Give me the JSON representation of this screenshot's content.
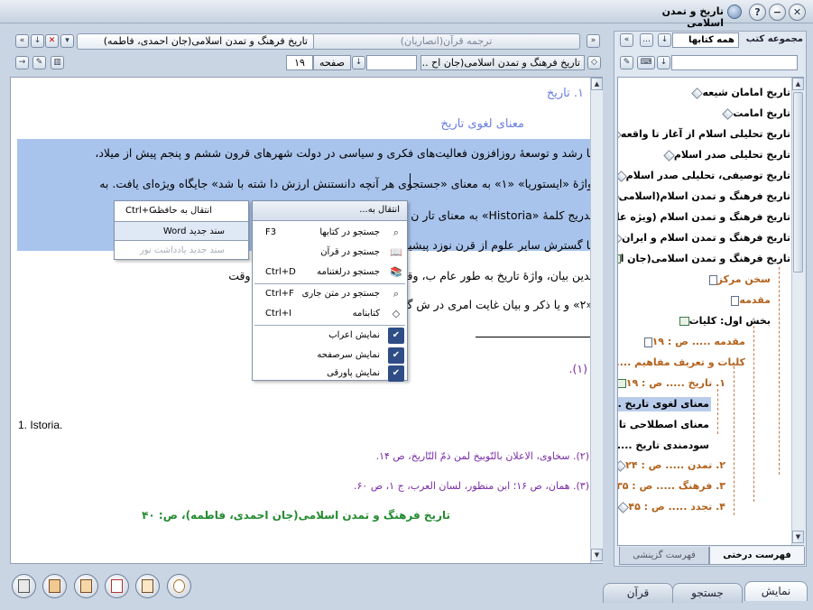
{
  "window": {
    "title": "تاریخ و تمدن اسلامی"
  },
  "doc_header": {
    "tab_primary": "تاریخ فرهنگ و تمدن اسلامی(جان احمدی، فاطمه)",
    "tab_secondary": "ترجمه قرآن(انصاریان)",
    "book_selector": "تاریخ فرهنگ و تمدن اسلامی(جان اح ...",
    "page_label": "صفحه",
    "page_value": "۱۹"
  },
  "right_header": {
    "title": "مجموعه کتب",
    "filter_value": "همه کتابها",
    "search_value": ""
  },
  "document": {
    "heading1": "۱. تاریخ",
    "heading2": "معنای لغوی تاریخ",
    "lines": [
      "یا رشد و توسعهٔ روزافزون فعالیت‌های فکری و سیاسی در دولت شهرهای قرون  ششم و پنجم پیش از میلاد،",
      "واژهٔ «ایستوریا» «۱» به معنای «جستجوی هر آنچه دانستنش ارزش دا شته با شد» جایگاه ویژه‌ای یافت. به",
      "تدریج کلمهٔ «Historia» به معنای تار                                                           ن خود را بازیافت.",
      "با گسترش سایر علوم از قرن نوزد                                                          پیشین یافت.",
      "بدین بیان، واژهٔ تاریخ به طور عام                                      ب، وقت و آگاهی‌دادن از آن، شناساندن وقت",
      "«۲» و یا ذکر و بیان غایت امری در                                     ش گذ شته، سیر زمان"
    ],
    "fn1": "(۱).",
    "fn1_en": "1. Istoria.",
    "fn2": "(۲). سخاوی، الاعلان بالتّوبیخ لمن ذمّ التّاریخ، ص ۱۴.",
    "fn3": "(۳). همان، ص ۱۶؛ ابن منظور، لسان العرب، ج ۱، ص ۶۰.",
    "footer": "تاریخ  فرهنگ  و  تمدن  اسلامی(جان  احمدی،  فاطمه)،  ص:  ۴۰"
  },
  "tree": {
    "items": [
      {
        "label": "تاریخ امامان شیعه",
        "icon": "book-diamond-icon"
      },
      {
        "label": "تاریخ امامت",
        "icon": "book-diamond-icon"
      },
      {
        "label": "تاریخ تحلیلی اسلام از آغاز تا واقعه",
        "icon": "book-diamond-icon"
      },
      {
        "label": "تاریخ تحلیلی صدر اسلام",
        "icon": "book-diamond-icon"
      },
      {
        "label": "تاریخ توصیفی، تحلیلی صدر اسلام",
        "icon": "book-diamond-icon"
      },
      {
        "label": "تاریخ فرهنگ و تمدن اسلام(اسلامی",
        "icon": "book-diamond-icon"
      },
      {
        "label": "تاریخ فرهنگ و تمدن اسلام (ویژه عا",
        "icon": "book-diamond-icon"
      },
      {
        "label": "تاریخ فرهنگ و تمدن اسلام و ایران",
        "icon": "book-diamond-icon"
      },
      {
        "label": "تاریخ فرهنگ و تمدن اسلامی(جان ا",
        "icon": "open-book-icon"
      }
    ],
    "children": [
      {
        "label": "سخن مرکز",
        "color": "orange"
      },
      {
        "label": "مقدمه",
        "color": "orange"
      },
      {
        "label": "بخش اول: کلیات",
        "color": "black"
      },
      {
        "label": "مقدمه ..... ص : ۱۹",
        "color": "orange"
      },
      {
        "label": "کلیات و تعریف مفاهیم ..... ص : ۱۹",
        "color": "orange"
      },
      {
        "label": "۱. تاریخ ..... ص : ۱۹",
        "color": "orange"
      },
      {
        "label": "معنای لغوی تاریخ ....",
        "color": "black"
      },
      {
        "label": "معنای اصطلاحی تاریخ",
        "color": "black"
      },
      {
        "label": "سودمندی تاریخ ....",
        "color": "black"
      },
      {
        "label": "۲. تمدن ..... ص : ۲۴",
        "color": "orange"
      },
      {
        "label": "۳. فرهنگ ..... ص : ۳۵",
        "color": "orange"
      },
      {
        "label": "۴. تجدد ..... ص : ۴۵",
        "color": "orange"
      }
    ]
  },
  "panel_tabs": {
    "tree": "فهرست درختی",
    "index": "فهرست گزینشی"
  },
  "bottom_tabs": {
    "display": "نمایش",
    "search": "جستجو",
    "quran": "قرآن"
  },
  "context_menu": {
    "goto": "انتقال به...",
    "items": [
      {
        "label": "جستجو در کتابها",
        "shortcut": "F3",
        "icon": "magnifier-icon"
      },
      {
        "label": "جستجو در قرآن",
        "shortcut": "",
        "icon": "quran-book-icon"
      },
      {
        "label": "جستجو درلغتنامه",
        "shortcut": "Ctrl+D",
        "icon": "dictionary-icon"
      },
      {
        "label": "جستجو در متن جاری",
        "shortcut": "Ctrl+F",
        "icon": "magnifier-icon"
      },
      {
        "label": "کتابنامه",
        "shortcut": "Ctrl+I",
        "icon": "bookmark-diamond-icon"
      },
      {
        "label": "نمایش اعراب",
        "shortcut": "",
        "icon": "check-icon"
      },
      {
        "label": "نمایش سرصفحه",
        "shortcut": "",
        "icon": "check-icon"
      },
      {
        "label": "نمایش پاورقی",
        "shortcut": "",
        "icon": "check-icon"
      }
    ]
  },
  "submenu": {
    "items": [
      {
        "label": "انتقال به حافظه",
        "shortcut": "Ctrl+C"
      },
      {
        "label": "سند جدید Word",
        "shortcut": ""
      },
      {
        "label": "سند جدید یادداشت نور",
        "shortcut": ""
      }
    ]
  }
}
